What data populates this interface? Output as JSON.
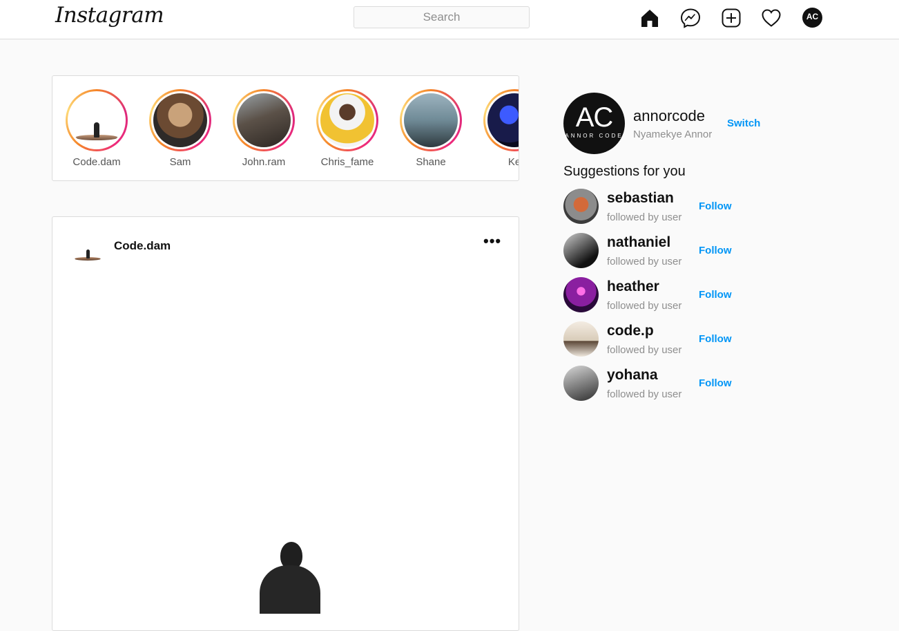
{
  "header": {
    "logo": "Instagram",
    "search_placeholder": "Search",
    "nav_icons": [
      "home-icon",
      "messenger-icon",
      "new-post-icon",
      "activity-heart-icon"
    ],
    "profile_avatar_text": "AC"
  },
  "stories": [
    {
      "name": "Code.dam"
    },
    {
      "name": "Sam"
    },
    {
      "name": "John.ram"
    },
    {
      "name": "Chris_fame"
    },
    {
      "name": "Shane"
    },
    {
      "name": "Ke"
    }
  ],
  "post": {
    "username": "Code.dam",
    "more": "•••"
  },
  "profile": {
    "avatar_text": "AC",
    "avatar_subtext": "ANNOR CODE",
    "username": "annorcode",
    "full_name": "Nyamekye Annor",
    "switch_label": "Switch"
  },
  "suggestions": {
    "title": "Suggestions for you",
    "follow_label": "Follow",
    "items": [
      {
        "name": "sebastian",
        "sub": "followed by user"
      },
      {
        "name": "nathaniel",
        "sub": "followed by user"
      },
      {
        "name": "heather",
        "sub": "followed by user"
      },
      {
        "name": "code.p",
        "sub": "followed by user"
      },
      {
        "name": "yohana",
        "sub": "followed by user"
      }
    ]
  },
  "colors": {
    "link_blue": "#0095f6",
    "story_ring_start": "#f58529",
    "story_ring_end": "#dd2a7b"
  }
}
